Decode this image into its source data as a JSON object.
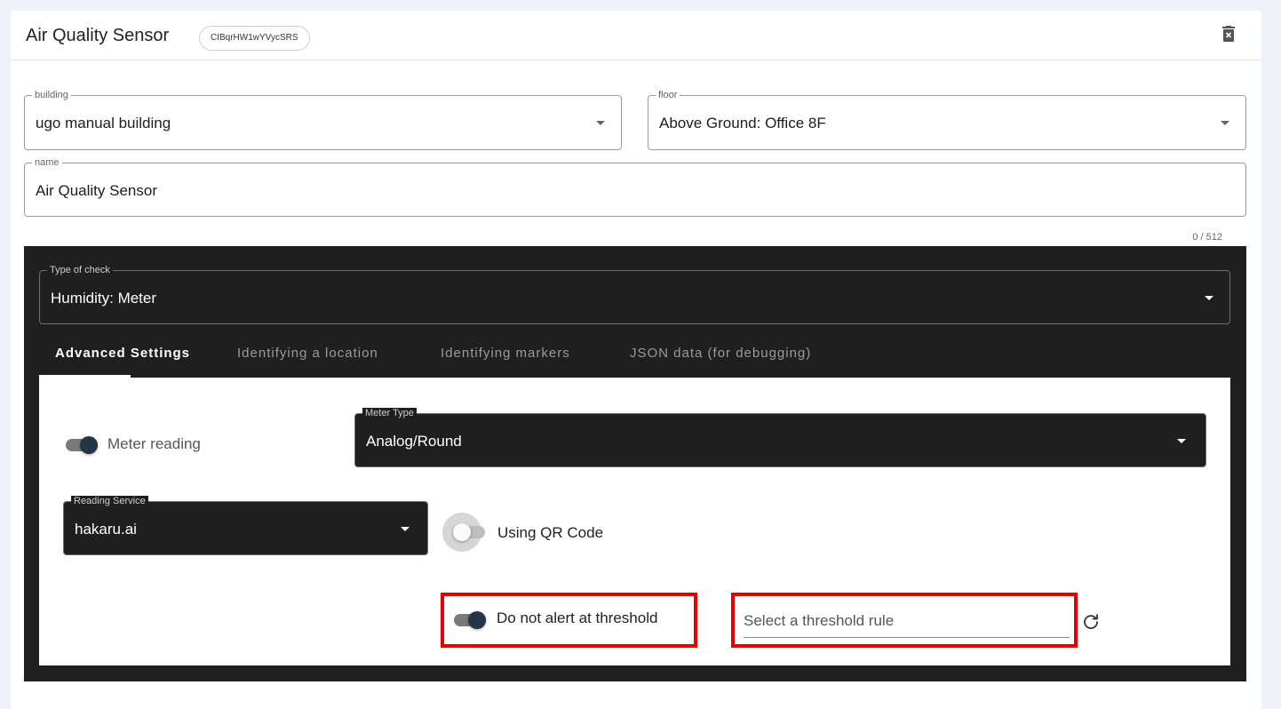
{
  "header": {
    "title": "Air Quality Sensor",
    "id_chip": "CIBqrHW1wYVycSRS",
    "delete_icon": "trash-icon"
  },
  "form": {
    "building": {
      "label": "building",
      "value": "ugo manual building"
    },
    "floor": {
      "label": "floor",
      "value": "Above Ground: Office 8F"
    },
    "name": {
      "label": "name",
      "value": "Air Quality Sensor",
      "counter": "0 / 512"
    }
  },
  "check": {
    "type_label": "Type of check",
    "type_value": "Humidity: Meter",
    "tabs": [
      {
        "label": "Advanced Settings",
        "active": true
      },
      {
        "label": "Identifying a location",
        "active": false
      },
      {
        "label": "Identifying markers",
        "active": false
      },
      {
        "label": "JSON data (for debugging)",
        "active": false
      }
    ],
    "advanced": {
      "meter_reading": {
        "label": "Meter reading",
        "checked": true
      },
      "meter_type": {
        "label": "Meter Type",
        "value": "Analog/Round"
      },
      "reading_service": {
        "label": "Reading Service",
        "value": "hakaru.ai"
      },
      "qr_code": {
        "label": "Using QR Code",
        "checked": false
      },
      "no_alert": {
        "label": "Do not alert at threshold",
        "checked": true
      },
      "threshold_rule": {
        "placeholder": "Select a threshold rule",
        "refresh_icon": "refresh-icon"
      }
    }
  },
  "colors": {
    "dark_panel": "#1f1f1f",
    "highlight": "#e60000",
    "switch_thumb": "#263545"
  }
}
